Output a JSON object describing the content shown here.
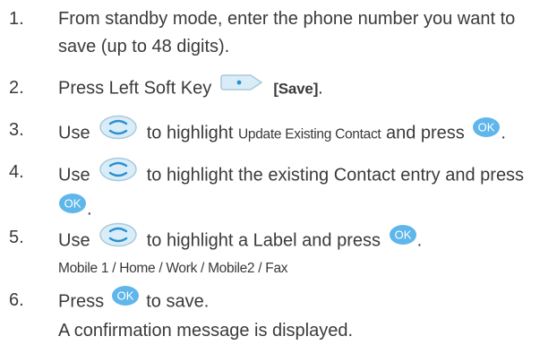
{
  "steps": [
    {
      "number": "1.",
      "line1": "From standby mode, enter the phone number you want to",
      "line2": "save (up to 48 digits)."
    },
    {
      "number": "2.",
      "text": "Press Left Soft Key",
      "key_label": "[Save]",
      "end": "."
    },
    {
      "number": "3.",
      "use": "Use",
      "highlight": "to highlight",
      "option": "Update Existing Contact",
      "and_press": "and press",
      "end": "."
    },
    {
      "number": "4.",
      "use": "Use",
      "line1_rest": "to highlight the existing Contact entry and press",
      "end": "."
    },
    {
      "number": "5.",
      "use": "Use",
      "line1_rest": "to highlight a Label and press",
      "end": ".",
      "labels": "Mobile 1 / Home / Work / Mobile2 / Fax"
    },
    {
      "number": "6.",
      "press": "Press",
      "rest": "to save.",
      "line2": "A confirmation message is displayed."
    }
  ],
  "icons": {
    "ok_key": "OK",
    "nav_key": "nav-key-icon",
    "soft_key": "left-soft-key-icon"
  },
  "colors": {
    "text": "#3a3a3a",
    "ok_fill": "#5fb6ea",
    "nav_fill": "#d9edf8",
    "nav_stroke": "#a9c9dc",
    "nav_arc": "#2a8fd0"
  }
}
